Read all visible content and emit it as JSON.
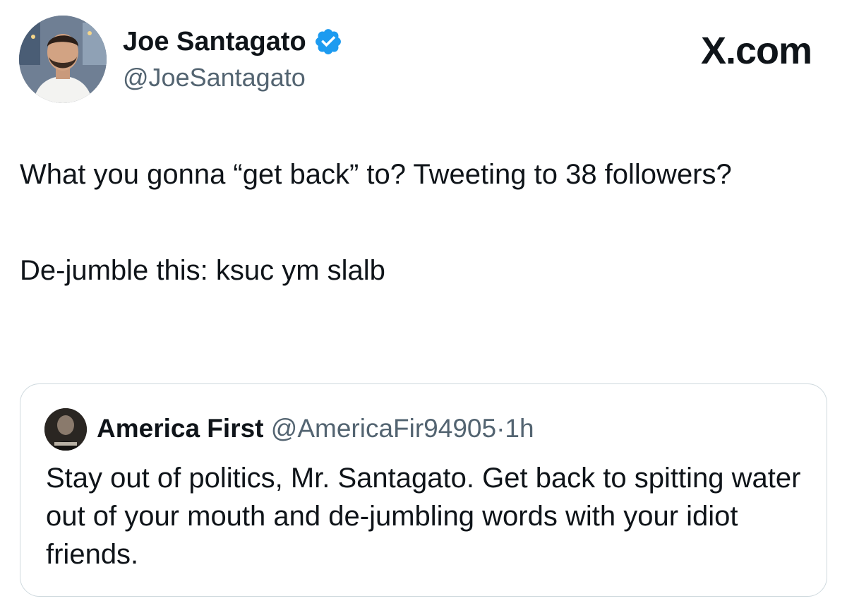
{
  "author": {
    "display_name": "Joe Santagato",
    "handle": "@JoeSantagato",
    "verified_icon": "verified-badge-icon",
    "avatar_icon": "profile-avatar"
  },
  "brand": {
    "label": "X.com"
  },
  "tweet": {
    "paragraphs": [
      "What you gonna “get back” to? Tweeting to 38 followers?",
      "De-jumble this: ksuc ym slalb"
    ]
  },
  "quoted_tweet": {
    "display_name": "America First",
    "handle": "@AmericaFir94905",
    "separator": "·",
    "time": "1h",
    "text": "Stay out of politics, Mr. Santagato. Get back to spitting water out of your mouth and de-jumbling words with your idiot friends."
  },
  "colors": {
    "verified_blue": "#1d9bf0",
    "secondary_text": "#536471",
    "primary_text": "#0f1419",
    "border": "#cfd9de"
  }
}
